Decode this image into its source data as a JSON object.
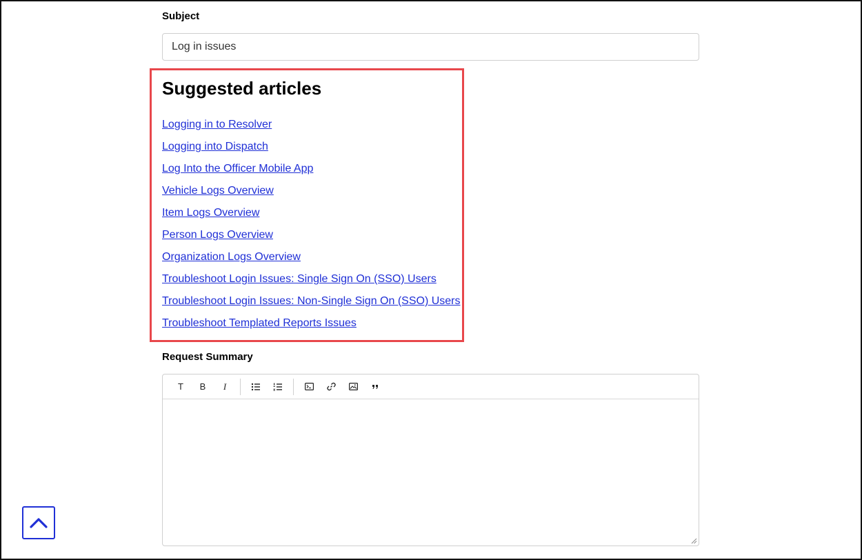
{
  "subject": {
    "label": "Subject",
    "value": "Log in issues"
  },
  "suggested": {
    "title": "Suggested articles",
    "articles": [
      "Logging in to Resolver",
      "Logging into Dispatch",
      "Log Into the Officer Mobile App",
      "Vehicle Logs Overview",
      "Item Logs Overview",
      "Person Logs Overview",
      "Organization Logs Overview",
      "Troubleshoot Login Issues: Single Sign On (SSO) Users",
      "Troubleshoot Login Issues: Non-Single Sign On (SSO) Users",
      "Troubleshoot Templated Reports Issues"
    ]
  },
  "summary": {
    "label": "Request Summary",
    "toolbar": {
      "text_style": "T",
      "bold": "B",
      "italic": "I"
    }
  },
  "colors": {
    "link": "#1f2fd6",
    "highlight_border": "#e8474b",
    "scroll_top_accent": "#1f2fd6"
  },
  "icons": {
    "scroll_top": "chevron-up-icon",
    "bullet_list": "bulleted-list-icon",
    "numbered_list": "numbered-list-icon",
    "code": "code-block-icon",
    "link": "link-icon",
    "image": "image-icon",
    "quote": "quote-icon"
  }
}
